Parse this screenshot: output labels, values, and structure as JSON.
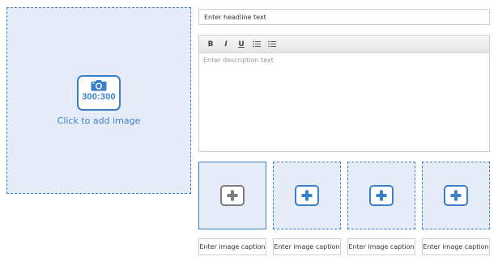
{
  "main_image": {
    "size_label": "300:300",
    "add_label": "Click to add image",
    "icon": "camera-icon"
  },
  "headline": {
    "placeholder": "Enter headline text"
  },
  "editor": {
    "toolbar": {
      "bold": "B",
      "italic": "I",
      "underline": "U",
      "bulleted_list_icon": "bulleted-list-icon",
      "numbered_list_icon": "numbered-list-icon"
    },
    "description_placeholder": "Enter description text"
  },
  "thumbnails": [
    {
      "caption_placeholder": "Enter image caption",
      "icon": "plus-icon",
      "state": "selected"
    },
    {
      "caption_placeholder": "Enter image caption",
      "icon": "plus-icon",
      "state": "empty"
    },
    {
      "caption_placeholder": "Enter image caption",
      "icon": "plus-icon",
      "state": "empty"
    },
    {
      "caption_placeholder": "Enter image caption",
      "icon": "plus-icon",
      "state": "empty"
    }
  ],
  "colors": {
    "accent": "#3a80c8",
    "placeholder_bg": "#e6ecf7",
    "inactive_icon": "#7d7d7d"
  }
}
